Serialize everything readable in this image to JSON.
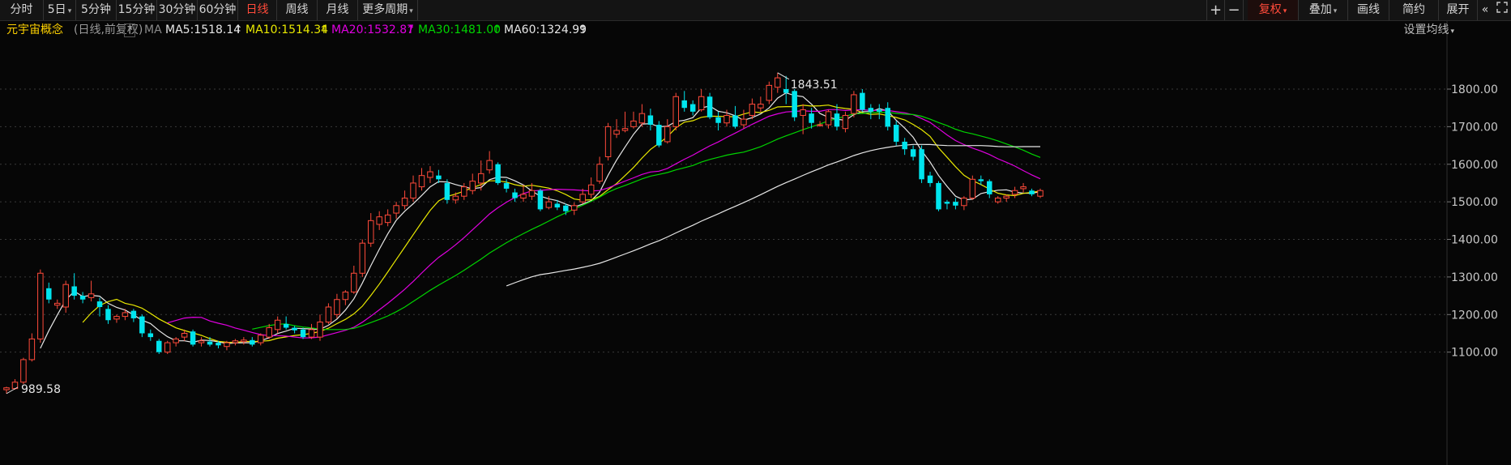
{
  "toolbar": {
    "left_buttons": [
      {
        "label": "分时"
      },
      {
        "label": "5日",
        "dropdown": true
      },
      {
        "label": "5分钟"
      },
      {
        "label": "15分钟"
      },
      {
        "label": "30分钟"
      },
      {
        "label": "60分钟"
      },
      {
        "label": "日线",
        "active": true
      },
      {
        "label": "周线"
      },
      {
        "label": "月线"
      },
      {
        "label": "更多周期",
        "dropdown": true
      }
    ],
    "zoom_in": "+",
    "zoom_out": "−",
    "right_buttons": [
      {
        "label": "复权",
        "dropdown": true,
        "highlight": true
      },
      {
        "label": "叠加",
        "dropdown": true
      },
      {
        "label": "画线"
      },
      {
        "label": "简约"
      },
      {
        "label": "展开"
      }
    ],
    "expand_icon": "«",
    "fullscreen_icon": "fullscreen-icon"
  },
  "info": {
    "name": "元宇宙概念",
    "mode": "(日线,前复权)",
    "help": "?",
    "ma_label": "MA",
    "ma5": "MA5:1518.14",
    "ma10": "MA10:1514.34",
    "ma20": "MA20:1532.87",
    "ma30": "MA30:1481.00",
    "ma60": "MA60:1324.99",
    "arrow": "↑",
    "settings": "设置均线"
  },
  "colors": {
    "up": "#ff4a3a",
    "down": "#00e5ee",
    "ma5": "#e6e6e6",
    "ma10": "#e8e800",
    "ma20": "#e000e0",
    "ma30": "#00d400",
    "ma60": "#e6e6e6",
    "name": "#ffd200",
    "axis_text": "#c8c8c8",
    "grid": "#3a3a3a"
  },
  "chart_data": {
    "type": "candlestick",
    "y_ticks": [
      1100,
      1200,
      1300,
      1400,
      1500,
      1600,
      1700,
      1800
    ],
    "y_tick_labels": [
      "1100.00",
      "1200.00",
      "1300.00",
      "1400.00",
      "1500.00",
      "1600.00",
      "1700.00",
      "1800.00"
    ],
    "ylim": [
      960,
      1905
    ],
    "grid": true,
    "max_label": "1843.51",
    "max_value": 1843.51,
    "min_label": "989.58",
    "min_value": 989.58,
    "candles": [
      [
        1000,
        1005,
        989.58,
        1008
      ],
      [
        1003,
        1020,
        1000,
        1028
      ],
      [
        1020,
        1080,
        1015,
        1085
      ],
      [
        1080,
        1135,
        1075,
        1150
      ],
      [
        1135,
        1310,
        1125,
        1320
      ],
      [
        1270,
        1240,
        1230,
        1285
      ],
      [
        1225,
        1230,
        1215,
        1240
      ],
      [
        1220,
        1280,
        1205,
        1290
      ],
      [
        1275,
        1250,
        1240,
        1310
      ],
      [
        1250,
        1240,
        1230,
        1260
      ],
      [
        1245,
        1255,
        1235,
        1290
      ],
      [
        1235,
        1220,
        1195,
        1245
      ],
      [
        1215,
        1185,
        1175,
        1225
      ],
      [
        1188,
        1195,
        1178,
        1200
      ],
      [
        1195,
        1205,
        1185,
        1215
      ],
      [
        1210,
        1190,
        1180,
        1215
      ],
      [
        1195,
        1150,
        1140,
        1200
      ],
      [
        1150,
        1140,
        1130,
        1160
      ],
      [
        1130,
        1100,
        1095,
        1135
      ],
      [
        1100,
        1125,
        1095,
        1130
      ],
      [
        1125,
        1135,
        1115,
        1140
      ],
      [
        1140,
        1150,
        1130,
        1160
      ],
      [
        1155,
        1120,
        1115,
        1160
      ],
      [
        1125,
        1130,
        1115,
        1140
      ],
      [
        1128,
        1120,
        1115,
        1140
      ],
      [
        1125,
        1118,
        1110,
        1130
      ],
      [
        1115,
        1125,
        1105,
        1130
      ],
      [
        1125,
        1130,
        1118,
        1135
      ],
      [
        1128,
        1132,
        1120,
        1140
      ],
      [
        1132,
        1120,
        1115,
        1140
      ],
      [
        1125,
        1145,
        1118,
        1150
      ],
      [
        1140,
        1165,
        1135,
        1175
      ],
      [
        1160,
        1185,
        1150,
        1195
      ],
      [
        1175,
        1165,
        1160,
        1195
      ],
      [
        1165,
        1158,
        1150,
        1170
      ],
      [
        1160,
        1140,
        1135,
        1165
      ],
      [
        1140,
        1160,
        1135,
        1175
      ],
      [
        1140,
        1180,
        1130,
        1200
      ],
      [
        1180,
        1220,
        1175,
        1230
      ],
      [
        1200,
        1240,
        1190,
        1255
      ],
      [
        1240,
        1260,
        1225,
        1265
      ],
      [
        1260,
        1310,
        1255,
        1330
      ],
      [
        1310,
        1390,
        1300,
        1400
      ],
      [
        1390,
        1450,
        1380,
        1470
      ],
      [
        1440,
        1460,
        1425,
        1475
      ],
      [
        1445,
        1465,
        1435,
        1480
      ],
      [
        1470,
        1490,
        1455,
        1500
      ],
      [
        1490,
        1510,
        1480,
        1530
      ],
      [
        1510,
        1550,
        1500,
        1570
      ],
      [
        1540,
        1570,
        1530,
        1590
      ],
      [
        1565,
        1580,
        1550,
        1595
      ],
      [
        1570,
        1560,
        1550,
        1585
      ],
      [
        1550,
        1505,
        1495,
        1560
      ],
      [
        1505,
        1515,
        1495,
        1525
      ],
      [
        1515,
        1540,
        1505,
        1550
      ],
      [
        1530,
        1555,
        1520,
        1575
      ],
      [
        1550,
        1575,
        1530,
        1610
      ],
      [
        1585,
        1610,
        1575,
        1635
      ],
      [
        1600,
        1550,
        1545,
        1605
      ],
      [
        1550,
        1535,
        1525,
        1560
      ],
      [
        1525,
        1510,
        1500,
        1535
      ],
      [
        1510,
        1520,
        1500,
        1545
      ],
      [
        1515,
        1530,
        1505,
        1550
      ],
      [
        1530,
        1480,
        1475,
        1535
      ],
      [
        1485,
        1500,
        1480,
        1515
      ],
      [
        1495,
        1485,
        1478,
        1505
      ],
      [
        1490,
        1475,
        1465,
        1495
      ],
      [
        1478,
        1490,
        1465,
        1498
      ],
      [
        1500,
        1520,
        1495,
        1535
      ],
      [
        1520,
        1545,
        1510,
        1565
      ],
      [
        1555,
        1600,
        1548,
        1620
      ],
      [
        1620,
        1700,
        1610,
        1710
      ],
      [
        1680,
        1690,
        1670,
        1720
      ],
      [
        1690,
        1695,
        1685,
        1740
      ],
      [
        1700,
        1715,
        1695,
        1740
      ],
      [
        1710,
        1735,
        1700,
        1760
      ],
      [
        1730,
        1705,
        1690,
        1748
      ],
      [
        1705,
        1650,
        1645,
        1715
      ],
      [
        1660,
        1700,
        1655,
        1720
      ],
      [
        1700,
        1780,
        1690,
        1790
      ],
      [
        1770,
        1750,
        1740,
        1795
      ],
      [
        1760,
        1740,
        1730,
        1770
      ],
      [
        1745,
        1780,
        1740,
        1800
      ],
      [
        1780,
        1725,
        1720,
        1790
      ],
      [
        1725,
        1710,
        1690,
        1740
      ],
      [
        1710,
        1730,
        1700,
        1745
      ],
      [
        1730,
        1700,
        1695,
        1755
      ],
      [
        1705,
        1720,
        1695,
        1745
      ],
      [
        1730,
        1760,
        1720,
        1775
      ],
      [
        1750,
        1760,
        1740,
        1780
      ],
      [
        1770,
        1810,
        1760,
        1820
      ],
      [
        1805,
        1830,
        1790,
        1843.51
      ],
      [
        1800,
        1790,
        1760,
        1835
      ],
      [
        1795,
        1725,
        1715,
        1800
      ],
      [
        1730,
        1745,
        1680,
        1760
      ],
      [
        1735,
        1710,
        1695,
        1750
      ],
      [
        1705,
        1705,
        1700,
        1715
      ],
      [
        1705,
        1740,
        1695,
        1745
      ],
      [
        1735,
        1700,
        1690,
        1760
      ],
      [
        1695,
        1730,
        1685,
        1740
      ],
      [
        1735,
        1785,
        1725,
        1795
      ],
      [
        1790,
        1745,
        1740,
        1800
      ],
      [
        1750,
        1740,
        1720,
        1760
      ],
      [
        1745,
        1740,
        1720,
        1760
      ],
      [
        1750,
        1700,
        1690,
        1765
      ],
      [
        1705,
        1660,
        1650,
        1715
      ],
      [
        1660,
        1640,
        1625,
        1670
      ],
      [
        1640,
        1620,
        1610,
        1650
      ],
      [
        1640,
        1560,
        1550,
        1650
      ],
      [
        1570,
        1550,
        1540,
        1580
      ],
      [
        1550,
        1480,
        1475,
        1555
      ],
      [
        1500,
        1495,
        1480,
        1505
      ],
      [
        1500,
        1490,
        1480,
        1510
      ],
      [
        1490,
        1510,
        1478,
        1515
      ],
      [
        1510,
        1560,
        1505,
        1570
      ],
      [
        1560,
        1555,
        1545,
        1570
      ],
      [
        1555,
        1520,
        1510,
        1560
      ],
      [
        1500,
        1510,
        1495,
        1515
      ],
      [
        1510,
        1515,
        1500,
        1520
      ],
      [
        1520,
        1530,
        1510,
        1540
      ],
      [
        1535,
        1540,
        1525,
        1550
      ],
      [
        1530,
        1520,
        1515,
        1535
      ],
      [
        1515,
        1530,
        1510,
        1535
      ]
    ],
    "ma5": [
      1550,
      1545,
      1530,
      1515,
      1510,
      1505,
      1508,
      1512,
      1518,
      1520,
      1518.14
    ],
    "ma10": [
      1720,
      1680,
      1640,
      1600,
      1570,
      1545,
      1530,
      1522,
      1518,
      1515,
      1514.34
    ],
    "ma20": [
      1750,
      1740,
      1725,
      1710,
      1690,
      1670,
      1650,
      1630,
      1610,
      1590,
      1560,
      1532.87
    ],
    "ma30": [
      1600,
      1620,
      1640,
      1660,
      1690,
      1720,
      1740,
      1730,
      1700,
      1670,
      1640,
      1610,
      1570,
      1481.0
    ],
    "ma60": [
      1280,
      1300,
      1330,
      1360,
      1400,
      1440,
      1480,
      1520,
      1560,
      1600,
      1620,
      1627,
      1625,
      1324.99
    ]
  }
}
